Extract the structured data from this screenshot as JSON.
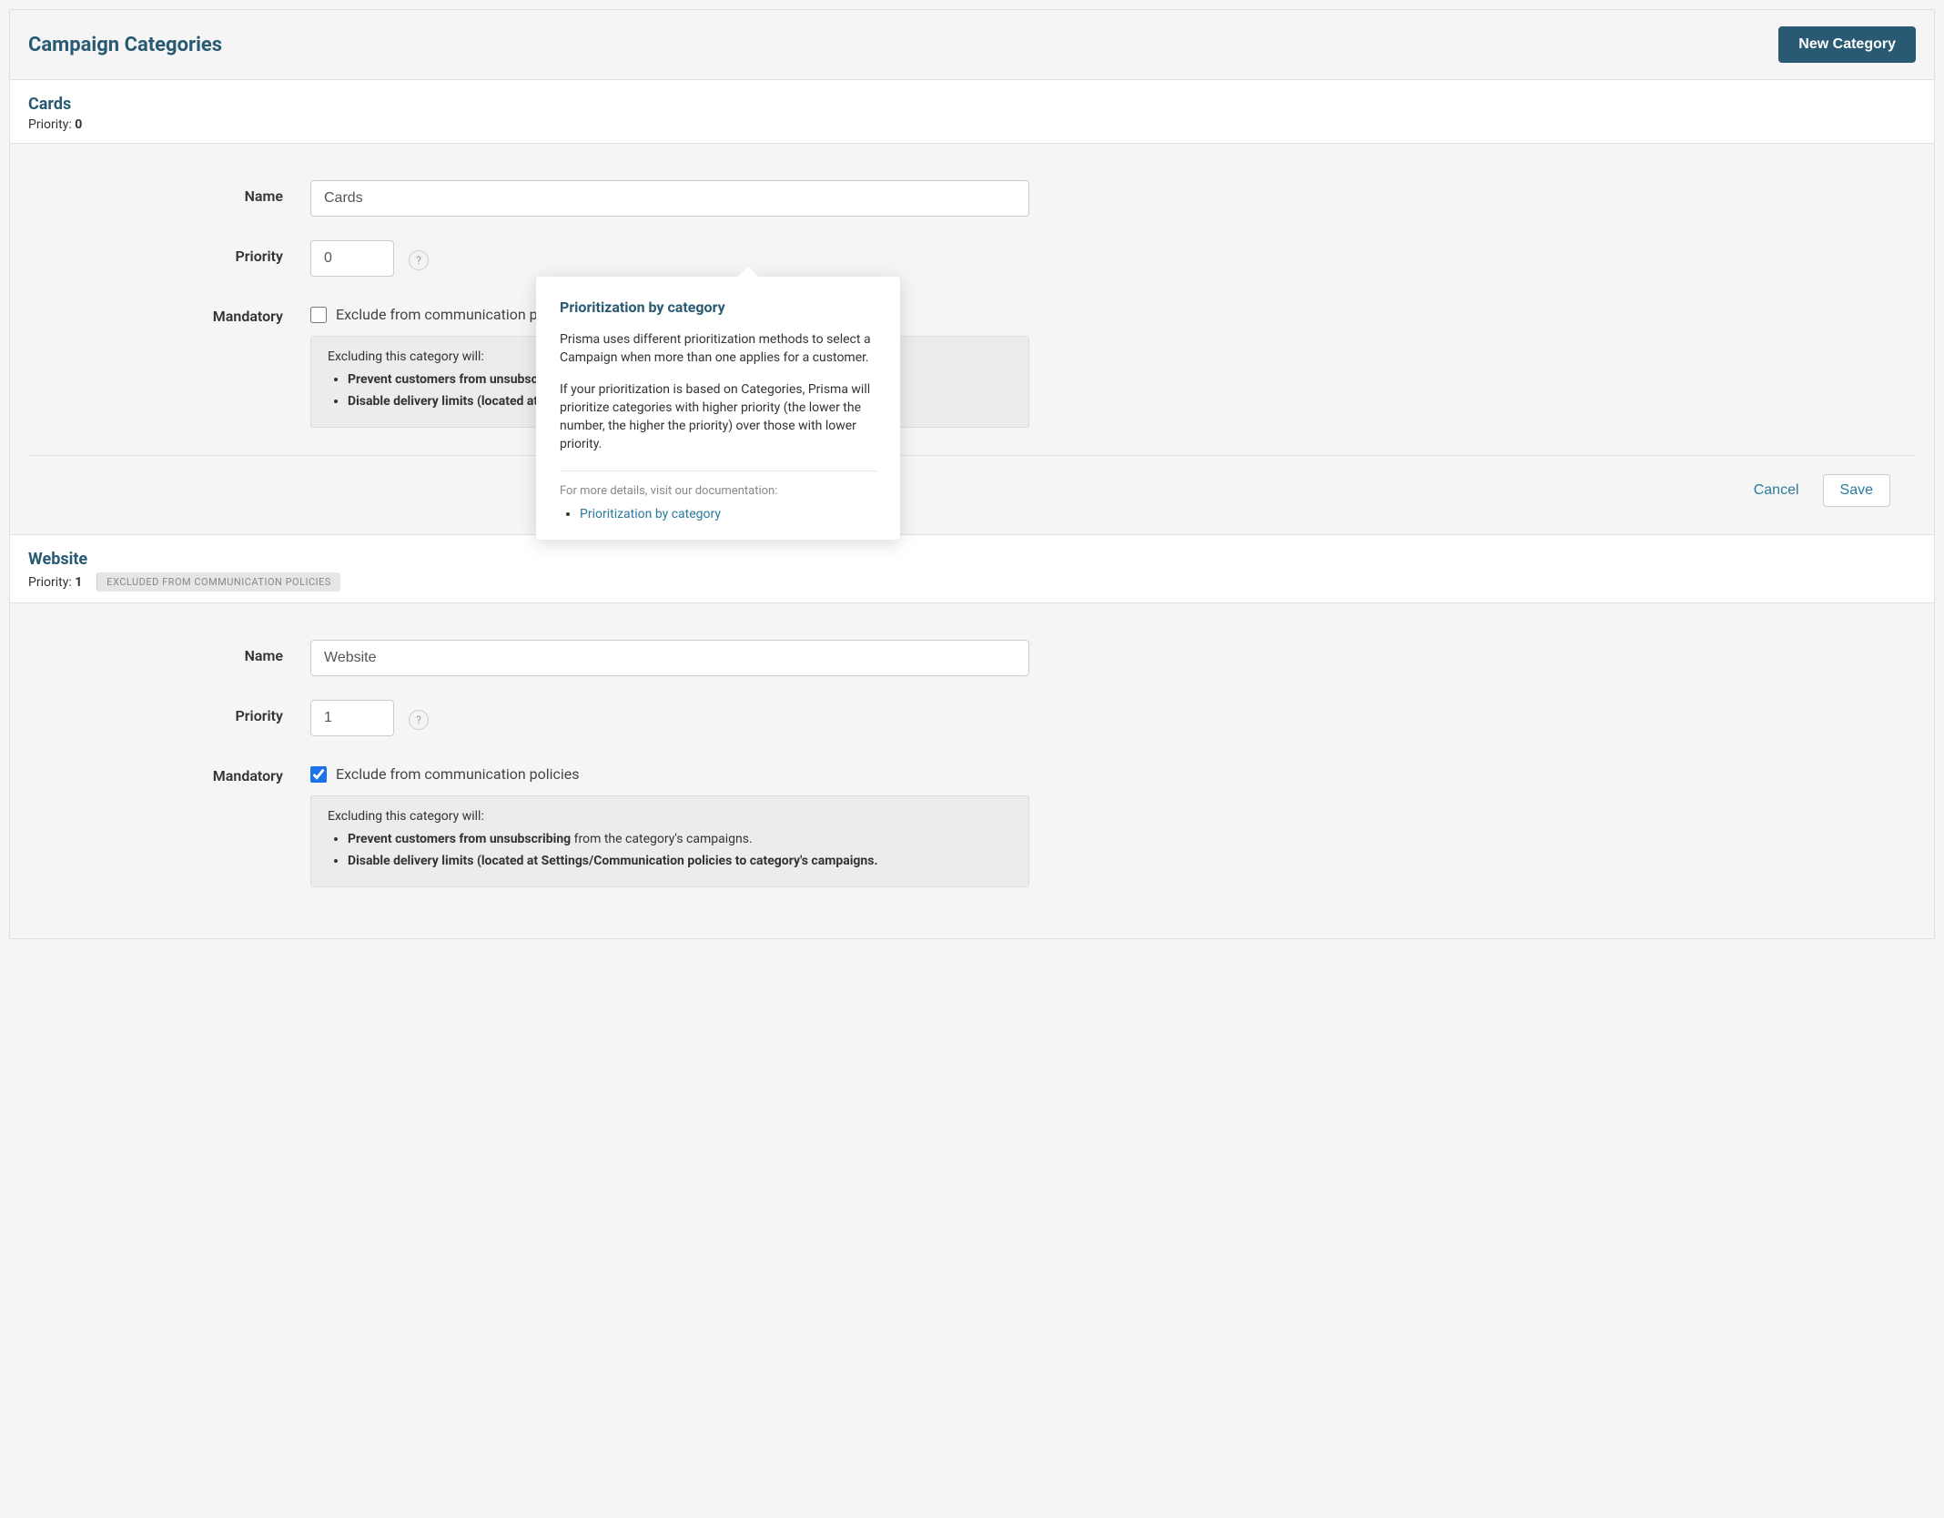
{
  "header": {
    "title": "Campaign Categories",
    "new_button": "New Category"
  },
  "labels": {
    "name": "Name",
    "priority": "Priority",
    "mandatory": "Mandatory",
    "priority_prefix": "Priority: ",
    "exclude_label": "Exclude from communication policies",
    "info_intro": "Excluding this category will:",
    "info_b1_bold": "Prevent customers from unsubscribing",
    "info_b1_rest": " from the category's campaigns.",
    "info_b2": "Disable delivery limits (located at Settings/Communication policies to category's campaigns.",
    "cancel": "Cancel",
    "save": "Save",
    "help_symbol": "?"
  },
  "popover": {
    "title": "Prioritization by category",
    "p1": "Prisma uses different prioritization methods to select a Campaign when more than one applies for a customer.",
    "p2": "If your prioritization is based on Categories, Prisma will prioritize categories with higher priority (the lower the number, the higher the priority) over those with lower priority.",
    "footer": "For more details, visit our documentation:",
    "link": "Prioritization by category"
  },
  "categories": [
    {
      "name": "Cards",
      "priority": "0",
      "excluded_badge": "",
      "exclude_checked": false,
      "show_popover": true,
      "show_buttons": true
    },
    {
      "name": "Website",
      "priority": "1",
      "excluded_badge": "EXCLUDED FROM COMMUNICATION POLICIES",
      "exclude_checked": true,
      "show_popover": false,
      "show_buttons": false
    }
  ]
}
